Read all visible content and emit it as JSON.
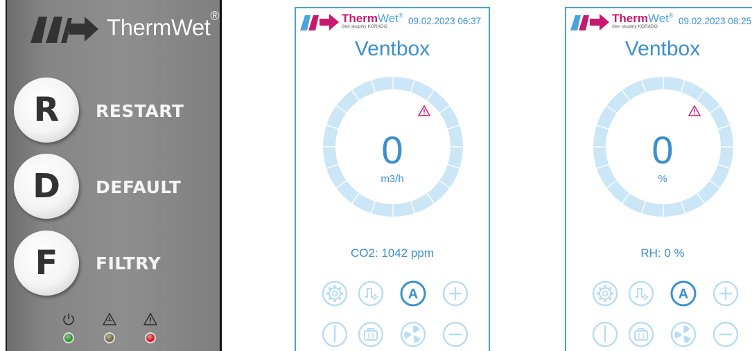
{
  "panel": {
    "brand": "ThermWet",
    "reg_mark": "®",
    "buttons": [
      {
        "letter": "R",
        "label": "RESTART"
      },
      {
        "letter": "D",
        "label": "DEFAULT"
      },
      {
        "letter": "F",
        "label": "FILTRY"
      }
    ],
    "leds": [
      {
        "icon": "power-icon",
        "color": "#2e9b2e"
      },
      {
        "icon": "warning-filter-icon",
        "color": "#7a6a4a"
      },
      {
        "icon": "warning-icon",
        "color": "#e8141c"
      }
    ]
  },
  "screens": [
    {
      "brand_therm": "Therm",
      "brand_wet": "Wet",
      "reg_mark": "®",
      "subtitle": "člen skupiny KORADO",
      "datetime": "09.02.2023 06:37",
      "title": "Ventbox",
      "value": "0",
      "unit": "m3/h",
      "reading": "CO2: 1042 ppm",
      "warning_icon": "warning-icon",
      "icons_row1": [
        "settings-icon",
        "schedule-icon",
        "auto-mode-icon",
        "plus-icon"
      ],
      "icons_row2": [
        "power-icon",
        "holiday-icon",
        "fan-icon",
        "minus-icon"
      ]
    },
    {
      "brand_therm": "Therm",
      "brand_wet": "Wet",
      "reg_mark": "®",
      "subtitle": "člen skupiny KORADO",
      "datetime": "09.02.2023 08:25",
      "title": "Ventbox",
      "value": "0",
      "unit": "%",
      "reading": "RH: 0 %",
      "warning_icon": "warning-icon",
      "icons_row1": [
        "settings-icon",
        "schedule-icon",
        "auto-mode-icon",
        "plus-icon"
      ],
      "icons_row2": [
        "power-icon",
        "holiday-icon",
        "fan-icon",
        "minus-icon"
      ]
    }
  ],
  "colors": {
    "accent": "#3a8fcf",
    "icon_light": "#b7dcf3",
    "gauge_ring": "#cbe6f7",
    "brand_magenta": "#c8196e",
    "brand_blue": "#4aa3dc"
  }
}
